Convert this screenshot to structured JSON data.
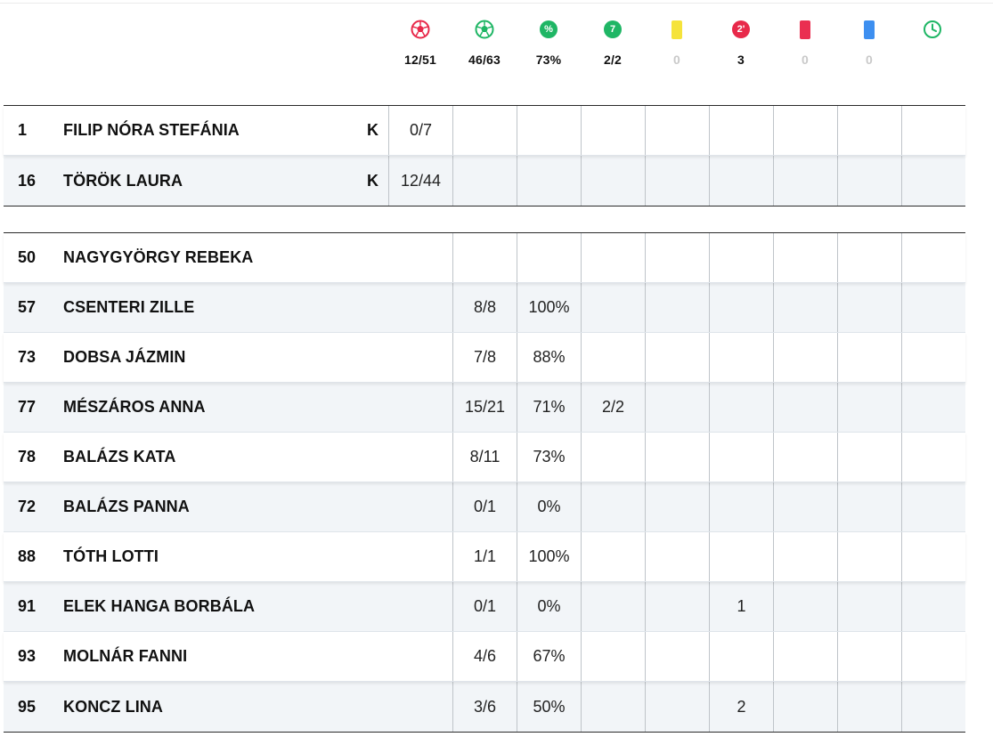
{
  "header_stats": [
    {
      "icon": "ball-missed-icon",
      "value": "12/51"
    },
    {
      "icon": "ball-goal-icon",
      "value": "46/63"
    },
    {
      "icon": "percent-icon",
      "value": "73%"
    },
    {
      "icon": "penalty-seven-icon",
      "value": "2/2"
    },
    {
      "icon": "yellow-card-icon",
      "value": "0"
    },
    {
      "icon": "two-minute-icon",
      "value": "3"
    },
    {
      "icon": "red-card-icon",
      "value": "0"
    },
    {
      "icon": "blue-card-icon",
      "value": "0"
    },
    {
      "icon": "clock-icon",
      "value": ""
    }
  ],
  "header_icon_text": {
    "percent": "%",
    "seven": "7",
    "two_min": "2'"
  },
  "colors": {
    "green": "#1fb665",
    "red": "#e8294a",
    "yellow": "#f5e33b",
    "blue": "#3d8ff0"
  },
  "goalkeepers": [
    {
      "number": "1",
      "name": "FILIP NÓRA STEFÁNIA",
      "pos": "K",
      "saves": "0/7"
    },
    {
      "number": "16",
      "name": "TÖRÖK LAURA",
      "pos": "K",
      "saves": "12/44"
    }
  ],
  "players": [
    {
      "number": "50",
      "name": "NAGYGYÖRGY REBEKA",
      "goals": "",
      "pct": "",
      "seven": "",
      "yellow": "",
      "twomin": "",
      "red": "",
      "blue": "",
      "time": ""
    },
    {
      "number": "57",
      "name": "CSENTERI ZILLE",
      "goals": "8/8",
      "pct": "100%",
      "seven": "",
      "yellow": "",
      "twomin": "",
      "red": "",
      "blue": "",
      "time": ""
    },
    {
      "number": "73",
      "name": "DOBSA JÁZMIN",
      "goals": "7/8",
      "pct": "88%",
      "seven": "",
      "yellow": "",
      "twomin": "",
      "red": "",
      "blue": "",
      "time": ""
    },
    {
      "number": "77",
      "name": "MÉSZÁROS ANNA",
      "goals": "15/21",
      "pct": "71%",
      "seven": "2/2",
      "yellow": "",
      "twomin": "",
      "red": "",
      "blue": "",
      "time": ""
    },
    {
      "number": "78",
      "name": "BALÁZS KATA",
      "goals": "8/11",
      "pct": "73%",
      "seven": "",
      "yellow": "",
      "twomin": "",
      "red": "",
      "blue": "",
      "time": ""
    },
    {
      "number": "72",
      "name": "BALÁZS PANNA",
      "goals": "0/1",
      "pct": "0%",
      "seven": "",
      "yellow": "",
      "twomin": "",
      "red": "",
      "blue": "",
      "time": ""
    },
    {
      "number": "88",
      "name": "TÓTH LOTTI",
      "goals": "1/1",
      "pct": "100%",
      "seven": "",
      "yellow": "",
      "twomin": "",
      "red": "",
      "blue": "",
      "time": ""
    },
    {
      "number": "91",
      "name": "ELEK HANGA BORBÁLA",
      "goals": "0/1",
      "pct": "0%",
      "seven": "",
      "yellow": "",
      "twomin": "1",
      "red": "",
      "blue": "",
      "time": ""
    },
    {
      "number": "93",
      "name": "MOLNÁR FANNI",
      "goals": "4/6",
      "pct": "67%",
      "seven": "",
      "yellow": "",
      "twomin": "",
      "red": "",
      "blue": "",
      "time": ""
    },
    {
      "number": "95",
      "name": "KONCZ LINA",
      "goals": "3/6",
      "pct": "50%",
      "seven": "",
      "yellow": "",
      "twomin": "2",
      "red": "",
      "blue": "",
      "time": ""
    }
  ]
}
